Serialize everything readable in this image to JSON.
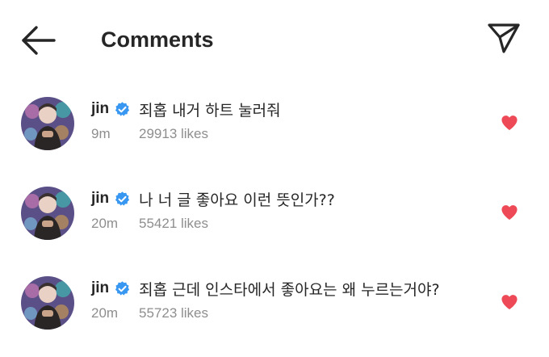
{
  "header": {
    "title": "Comments",
    "back_icon": "arrow-left-icon",
    "send_icon": "paper-plane-icon"
  },
  "colors": {
    "verified_badge": "#3897f0",
    "liked_heart": "#ed4956",
    "meta_text": "#8e8e8e",
    "primary_text": "#262626"
  },
  "comments": [
    {
      "username": "jin",
      "verified": true,
      "text": "죄홉 내거 하트 눌러줘",
      "time": "9m",
      "likes": "29913 likes",
      "liked": true
    },
    {
      "username": "jin",
      "verified": true,
      "text": "나 너 글 좋아요 이런 뜻인가??",
      "time": "20m",
      "likes": "55421 likes",
      "liked": true
    },
    {
      "username": "jin",
      "verified": true,
      "text": "죄홉 근데 인스타에서 좋아요는 왜 누르는거야?",
      "time": "20m",
      "likes": "55723 likes",
      "liked": true
    }
  ]
}
